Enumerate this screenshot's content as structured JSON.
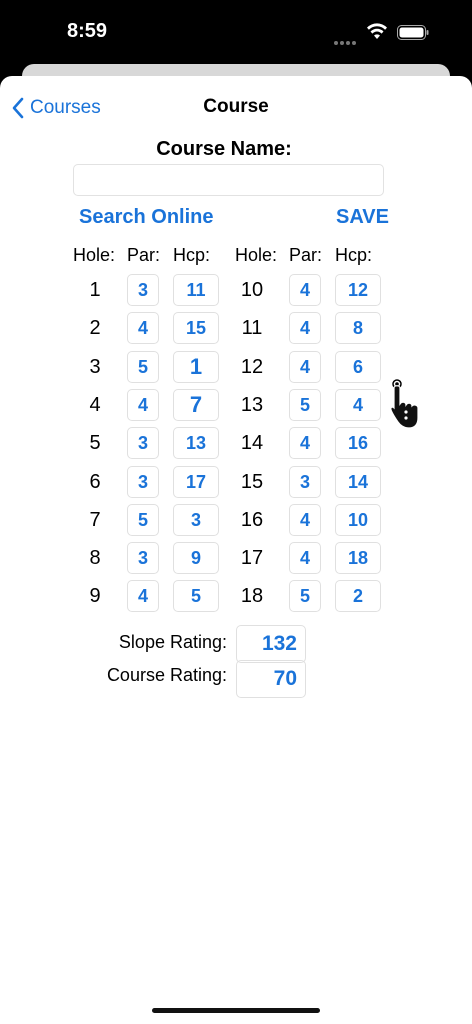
{
  "status": {
    "time": "8:59"
  },
  "nav": {
    "back_label": "Courses",
    "title": "Course"
  },
  "form": {
    "course_name_label": "Course Name:",
    "course_name_value": "",
    "search_label": "Search Online",
    "save_label": "SAVE"
  },
  "headers": {
    "hole": "Hole:",
    "par": "Par:",
    "hcp": "Hcp:"
  },
  "front_nine": [
    {
      "hole": "1",
      "par": "3",
      "hcp": "11"
    },
    {
      "hole": "2",
      "par": "4",
      "hcp": "15"
    },
    {
      "hole": "3",
      "par": "5",
      "hcp": "1"
    },
    {
      "hole": "4",
      "par": "4",
      "hcp": "7"
    },
    {
      "hole": "5",
      "par": "3",
      "hcp": "13"
    },
    {
      "hole": "6",
      "par": "3",
      "hcp": "17"
    },
    {
      "hole": "7",
      "par": "5",
      "hcp": "3"
    },
    {
      "hole": "8",
      "par": "3",
      "hcp": "9"
    },
    {
      "hole": "9",
      "par": "4",
      "hcp": "5"
    }
  ],
  "back_nine": [
    {
      "hole": "10",
      "par": "4",
      "hcp": "12"
    },
    {
      "hole": "11",
      "par": "4",
      "hcp": "8"
    },
    {
      "hole": "12",
      "par": "4",
      "hcp": "6"
    },
    {
      "hole": "13",
      "par": "5",
      "hcp": "4"
    },
    {
      "hole": "14",
      "par": "4",
      "hcp": "16"
    },
    {
      "hole": "15",
      "par": "3",
      "hcp": "14"
    },
    {
      "hole": "16",
      "par": "4",
      "hcp": "10"
    },
    {
      "hole": "17",
      "par": "4",
      "hcp": "18"
    },
    {
      "hole": "18",
      "par": "5",
      "hcp": "2"
    }
  ],
  "ratings": {
    "slope_label": "Slope Rating:",
    "slope_value": "132",
    "course_label": "Course Rating:",
    "course_value": "70"
  },
  "colors": {
    "accent": "#1a73d9"
  }
}
